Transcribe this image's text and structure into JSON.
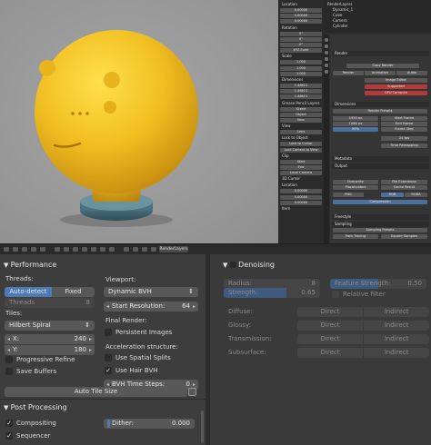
{
  "viewport": {
    "character_colors": {
      "body": "#f0c22a",
      "stand": "#3f6472"
    }
  },
  "npanel": {
    "fields": [
      "Location",
      "0.00000",
      "0.00000",
      "0.00000",
      "Rotation",
      "0°",
      "0°",
      "0°",
      "XYZ Euler",
      "Scale",
      "1.000",
      "1.000",
      "1.000",
      "Dimensions",
      "1.48621",
      "1.48621",
      "1.48621",
      "Grease Pencil Layers",
      "Scene",
      "Object",
      "New",
      "View",
      "Lens",
      "Lock to Object",
      "Lock to Cursor",
      "Lock Camera to View",
      "Clip",
      "Start",
      "End",
      "Local Camera",
      "3D Cursor",
      "Location",
      "0.00000",
      "0.00000",
      "0.00000",
      "Item"
    ]
  },
  "outliner": {
    "rows": [
      "RenderLayers",
      "Dynamic_1",
      "Cube",
      "Camera",
      "Cylinder"
    ]
  },
  "properties": {
    "sections": [
      "Render",
      "Dimensions",
      "Metadata",
      "Output",
      "Freestyle",
      "Sampling"
    ],
    "fields": [
      "Copy Render",
      "Render",
      "Animation",
      "Audio",
      "Image Editor",
      "Supported",
      "GPU Compute",
      "Render Presets",
      "1920 px",
      "1080 px",
      "50%",
      "Start Frame",
      "End Frame",
      "Frame Step",
      "24 fps",
      "Time Remapping",
      "Overwrite",
      "File Extensions",
      "Placeholders",
      "Cache Result",
      "PNG",
      "RGB",
      "RGBA",
      "Compression",
      "Sampling Presets",
      "Path Tracing",
      "Square Samples",
      "Render",
      "Preview"
    ]
  },
  "strip": {
    "selector": "RenderLayers"
  },
  "performance": {
    "title": "Performance",
    "threads_label": "Threads:",
    "threads_auto": "Auto-detect",
    "threads_fixed": "Fixed",
    "threads_value_label": "Threads",
    "threads_value": "8",
    "tiles_label": "Tiles:",
    "tiles_order": "Hilbert Spiral",
    "tile_x_label": "X:",
    "tile_x": "240",
    "tile_y_label": "Y:",
    "tile_y": "180",
    "progressive_refine": "Progressive Refine",
    "save_buffers": "Save Buffers",
    "viewport_label": "Viewport:",
    "viewport_bvh": "Dynamic BVH",
    "start_res_label": "Start Resolution:",
    "start_res": "64",
    "final_render_label": "Final Render:",
    "persistent_images": "Persistent Images",
    "accel_label": "Acceleration structure:",
    "spatial_splits": "Use Spatial Splits",
    "hair_bvh": "Use Hair BVH",
    "bvh_steps_label": "BVH Time Steps:",
    "bvh_steps": "0",
    "auto_tile_size": "Auto Tile Size"
  },
  "post_processing": {
    "title": "Post Processing",
    "compositing": "Compositing",
    "sequencer": "Sequencer",
    "dither_label": "Dither:",
    "dither_value": "0.000"
  },
  "denoising": {
    "title": "Denoising",
    "radius_label": "Radius:",
    "radius": "8",
    "feature_strength_label": "Feature Strength:",
    "feature_strength": "0.50",
    "strength_label": "Strength:",
    "strength": "0.65",
    "strength_level": 0.65,
    "relative_filter": "Relative filter",
    "rows": [
      {
        "label": "Diffuse:",
        "a": "Direct",
        "b": "Indirect"
      },
      {
        "label": "Glossy:",
        "a": "Direct",
        "b": "Indirect"
      },
      {
        "label": "Transmission:",
        "a": "Direct",
        "b": "Indirect"
      },
      {
        "label": "Subsurface:",
        "a": "Direct",
        "b": "Indirect"
      }
    ]
  },
  "colors": {
    "accent": "#4d7ab3",
    "panel": "#3d3d3d",
    "field": "#585858"
  }
}
